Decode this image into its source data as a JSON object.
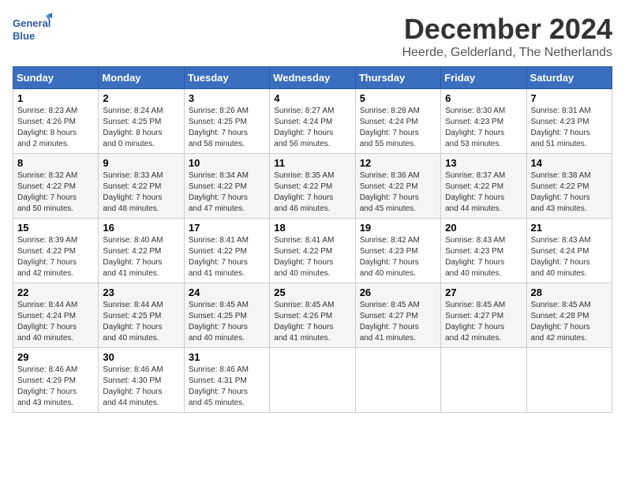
{
  "header": {
    "logo_line1": "General",
    "logo_line2": "Blue",
    "month_title": "December 2024",
    "location": "Heerde, Gelderland, The Netherlands"
  },
  "weekdays": [
    "Sunday",
    "Monday",
    "Tuesday",
    "Wednesday",
    "Thursday",
    "Friday",
    "Saturday"
  ],
  "weeks": [
    [
      {
        "day": "1",
        "sunrise": "8:23 AM",
        "sunset": "4:26 PM",
        "daylight": "8 hours and 2 minutes."
      },
      {
        "day": "2",
        "sunrise": "8:24 AM",
        "sunset": "4:25 PM",
        "daylight": "8 hours and 0 minutes."
      },
      {
        "day": "3",
        "sunrise": "8:26 AM",
        "sunset": "4:25 PM",
        "daylight": "7 hours and 58 minutes."
      },
      {
        "day": "4",
        "sunrise": "8:27 AM",
        "sunset": "4:24 PM",
        "daylight": "7 hours and 56 minutes."
      },
      {
        "day": "5",
        "sunrise": "8:28 AM",
        "sunset": "4:24 PM",
        "daylight": "7 hours and 55 minutes."
      },
      {
        "day": "6",
        "sunrise": "8:30 AM",
        "sunset": "4:23 PM",
        "daylight": "7 hours and 53 minutes."
      },
      {
        "day": "7",
        "sunrise": "8:31 AM",
        "sunset": "4:23 PM",
        "daylight": "7 hours and 51 minutes."
      }
    ],
    [
      {
        "day": "8",
        "sunrise": "8:32 AM",
        "sunset": "4:22 PM",
        "daylight": "7 hours and 50 minutes."
      },
      {
        "day": "9",
        "sunrise": "8:33 AM",
        "sunset": "4:22 PM",
        "daylight": "7 hours and 48 minutes."
      },
      {
        "day": "10",
        "sunrise": "8:34 AM",
        "sunset": "4:22 PM",
        "daylight": "7 hours and 47 minutes."
      },
      {
        "day": "11",
        "sunrise": "8:35 AM",
        "sunset": "4:22 PM",
        "daylight": "7 hours and 46 minutes."
      },
      {
        "day": "12",
        "sunrise": "8:36 AM",
        "sunset": "4:22 PM",
        "daylight": "7 hours and 45 minutes."
      },
      {
        "day": "13",
        "sunrise": "8:37 AM",
        "sunset": "4:22 PM",
        "daylight": "7 hours and 44 minutes."
      },
      {
        "day": "14",
        "sunrise": "8:38 AM",
        "sunset": "4:22 PM",
        "daylight": "7 hours and 43 minutes."
      }
    ],
    [
      {
        "day": "15",
        "sunrise": "8:39 AM",
        "sunset": "4:22 PM",
        "daylight": "7 hours and 42 minutes."
      },
      {
        "day": "16",
        "sunrise": "8:40 AM",
        "sunset": "4:22 PM",
        "daylight": "7 hours and 41 minutes."
      },
      {
        "day": "17",
        "sunrise": "8:41 AM",
        "sunset": "4:22 PM",
        "daylight": "7 hours and 41 minutes."
      },
      {
        "day": "18",
        "sunrise": "8:41 AM",
        "sunset": "4:22 PM",
        "daylight": "7 hours and 40 minutes."
      },
      {
        "day": "19",
        "sunrise": "8:42 AM",
        "sunset": "4:23 PM",
        "daylight": "7 hours and 40 minutes."
      },
      {
        "day": "20",
        "sunrise": "8:43 AM",
        "sunset": "4:23 PM",
        "daylight": "7 hours and 40 minutes."
      },
      {
        "day": "21",
        "sunrise": "8:43 AM",
        "sunset": "4:24 PM",
        "daylight": "7 hours and 40 minutes."
      }
    ],
    [
      {
        "day": "22",
        "sunrise": "8:44 AM",
        "sunset": "4:24 PM",
        "daylight": "7 hours and 40 minutes."
      },
      {
        "day": "23",
        "sunrise": "8:44 AM",
        "sunset": "4:25 PM",
        "daylight": "7 hours and 40 minutes."
      },
      {
        "day": "24",
        "sunrise": "8:45 AM",
        "sunset": "4:25 PM",
        "daylight": "7 hours and 40 minutes."
      },
      {
        "day": "25",
        "sunrise": "8:45 AM",
        "sunset": "4:26 PM",
        "daylight": "7 hours and 41 minutes."
      },
      {
        "day": "26",
        "sunrise": "8:45 AM",
        "sunset": "4:27 PM",
        "daylight": "7 hours and 41 minutes."
      },
      {
        "day": "27",
        "sunrise": "8:45 AM",
        "sunset": "4:27 PM",
        "daylight": "7 hours and 42 minutes."
      },
      {
        "day": "28",
        "sunrise": "8:45 AM",
        "sunset": "4:28 PM",
        "daylight": "7 hours and 42 minutes."
      }
    ],
    [
      {
        "day": "29",
        "sunrise": "8:46 AM",
        "sunset": "4:29 PM",
        "daylight": "7 hours and 43 minutes."
      },
      {
        "day": "30",
        "sunrise": "8:46 AM",
        "sunset": "4:30 PM",
        "daylight": "7 hours and 44 minutes."
      },
      {
        "day": "31",
        "sunrise": "8:46 AM",
        "sunset": "4:31 PM",
        "daylight": "7 hours and 45 minutes."
      },
      null,
      null,
      null,
      null
    ]
  ],
  "labels": {
    "sunrise": "Sunrise:",
    "sunset": "Sunset:",
    "daylight": "Daylight hours"
  }
}
